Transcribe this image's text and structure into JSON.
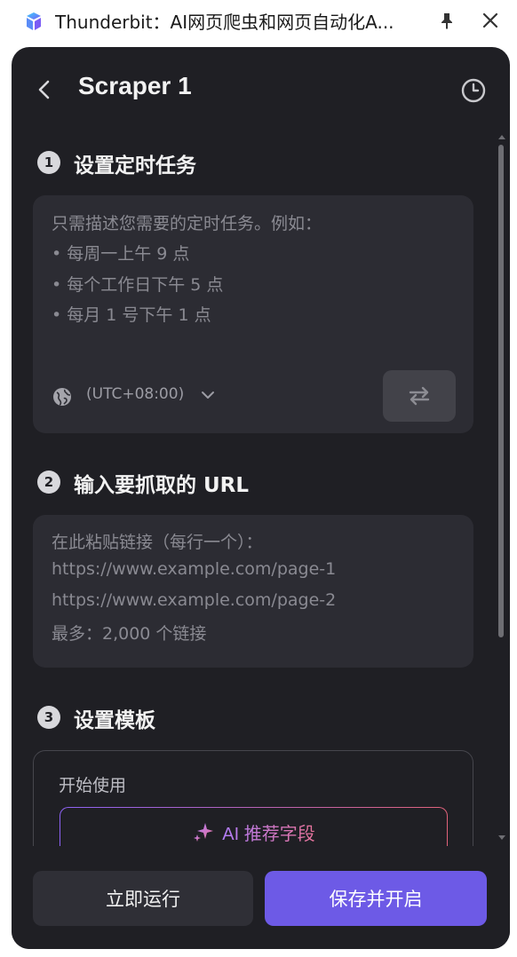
{
  "window": {
    "title": "Thunderbit：AI网页爬虫和网页自动化A..."
  },
  "header": {
    "title": "Scraper 1"
  },
  "sections": [
    {
      "number": "1",
      "title": "设置定时任务",
      "placeholder_lines": [
        "只需描述您需要的定时任务。例如：",
        "• 每周一上午 9 点",
        "• 每个工作日下午 5 点",
        "• 每月 1 号下午 1 点"
      ],
      "timezone": "(UTC+08:00)"
    },
    {
      "number": "2",
      "title": "输入要抓取的 URL",
      "placeholder_lines": [
        "在此粘贴链接（每行一个）：",
        "https://www.example.com/page-1",
        "https://www.example.com/page-2",
        "最多：2,000 个链接"
      ]
    },
    {
      "number": "3",
      "title": "设置模板",
      "start_label": "开始使用",
      "ai_button": "AI 推荐字段"
    }
  ],
  "footer": {
    "run_label": "立即运行",
    "save_label": "保存并开启"
  },
  "colors": {
    "panel_bg": "#1f1f24",
    "card_bg": "#2c2c33",
    "primary": "#6d5ae6",
    "gradient_start": "#8d62f5",
    "gradient_end": "#e0627a"
  }
}
